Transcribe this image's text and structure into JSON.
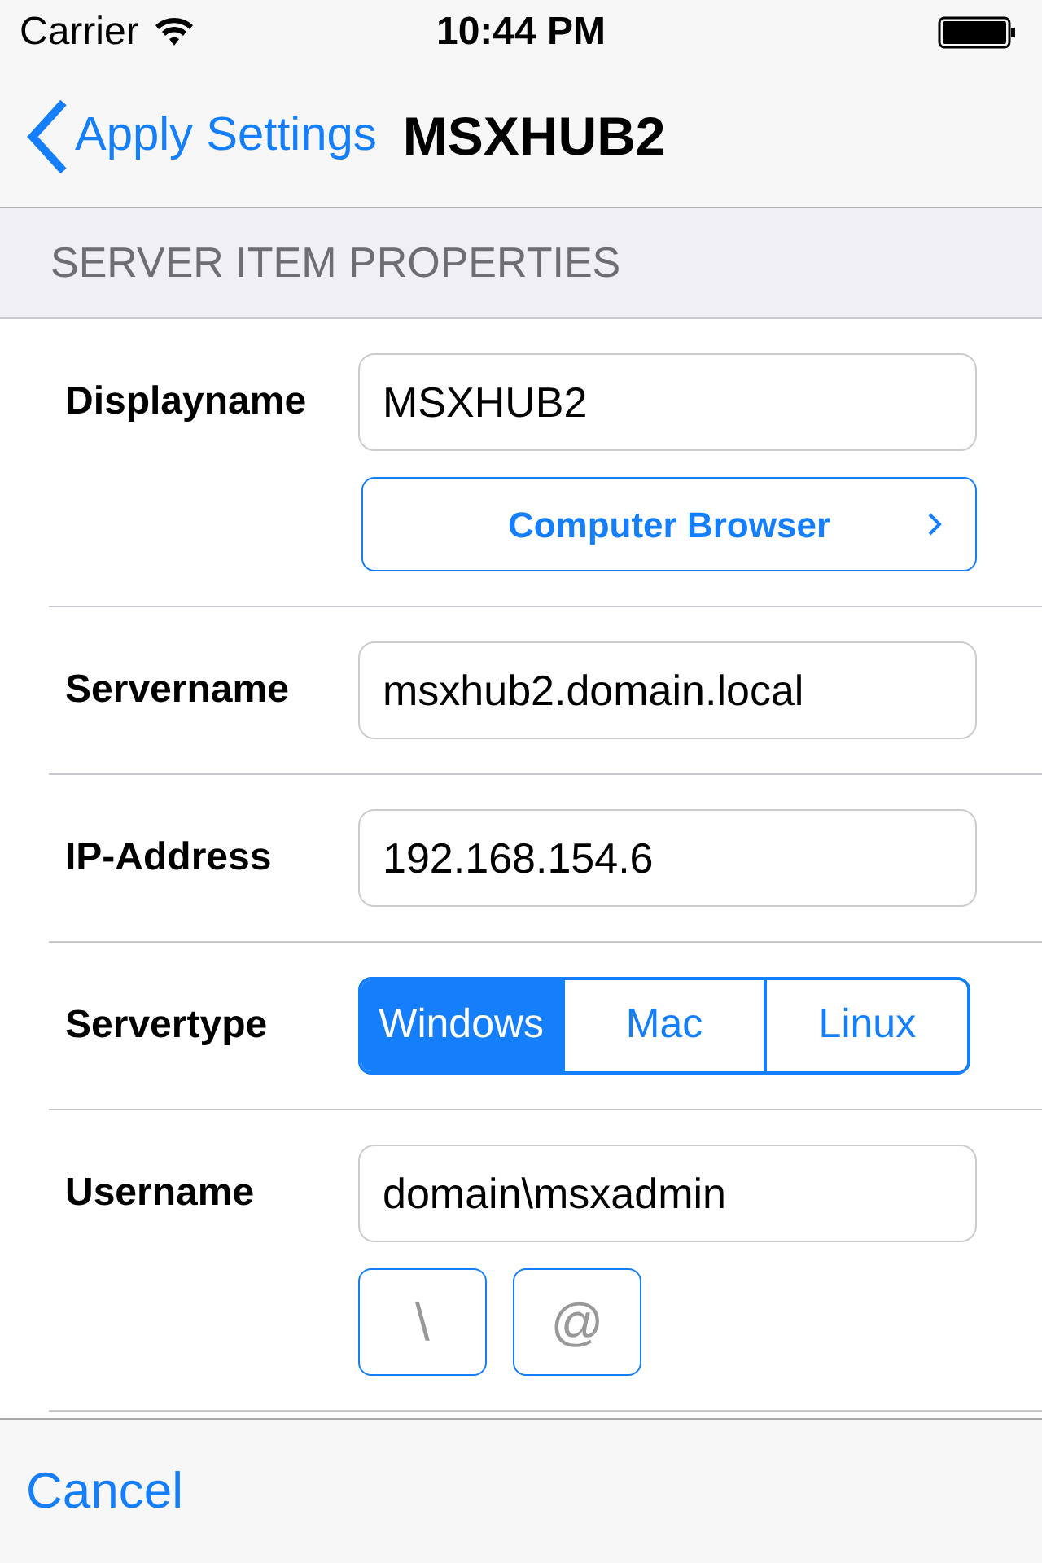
{
  "status_bar": {
    "carrier": "Carrier",
    "time": "10:44 PM"
  },
  "nav": {
    "back": "Apply Settings",
    "title": "MSXHUB2"
  },
  "section": {
    "header": "SERVER ITEM PROPERTIES"
  },
  "rows": [
    {
      "kind": "field",
      "label": "Displayname",
      "value": "MSXHUB2",
      "button": "Computer Browser"
    },
    {
      "kind": "field",
      "label": "Servername",
      "value": "msxhub2.domain.local"
    },
    {
      "kind": "field",
      "label": "IP-Address",
      "value": "192.168.154.6"
    },
    {
      "kind": "segments",
      "label": "Servertype",
      "segments": [
        {
          "label": "Windows",
          "selected": true
        },
        {
          "label": "Mac",
          "selected": false
        },
        {
          "label": "Linux",
          "selected": false
        }
      ]
    },
    {
      "kind": "field",
      "label": "Username",
      "value": "domain\\msxadmin",
      "keys": [
        "\\",
        "@"
      ]
    }
  ],
  "toolbar": {
    "cancel": "Cancel"
  }
}
